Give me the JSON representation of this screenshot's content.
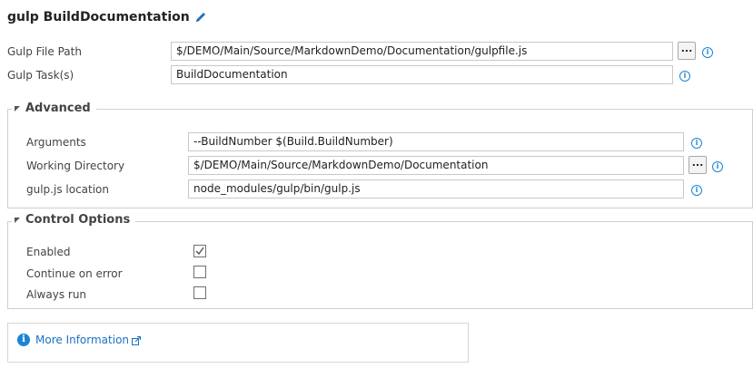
{
  "header": {
    "title": "gulp BuildDocumentation",
    "edit_icon": "pencil-icon"
  },
  "main_fields": {
    "gulp_file_path": {
      "label": "Gulp File Path",
      "value": "$/DEMO/Main/Source/MarkdownDemo/Documentation/gulpfile.js",
      "browse_label": "..."
    },
    "gulp_tasks": {
      "label": "Gulp Task(s)",
      "value": "BuildDocumentation"
    }
  },
  "advanced": {
    "title": "Advanced",
    "arguments": {
      "label": "Arguments",
      "value": "--BuildNumber $(Build.BuildNumber)"
    },
    "working_directory": {
      "label": "Working Directory",
      "value": "$/DEMO/Main/Source/MarkdownDemo/Documentation",
      "browse_label": "..."
    },
    "gulpjs_location": {
      "label": "gulp.js location",
      "value": "node_modules/gulp/bin/gulp.js"
    }
  },
  "control_options": {
    "title": "Control Options",
    "enabled": {
      "label": "Enabled",
      "checked": true
    },
    "continue_on_error": {
      "label": "Continue on error",
      "checked": false
    },
    "always_run": {
      "label": "Always run",
      "checked": false
    }
  },
  "more_information": {
    "label": "More Information",
    "icon": "info-icon",
    "external_icon": "external-link-icon"
  },
  "colors": {
    "accent": "#1a85d4",
    "link": "#1a72c2",
    "border": "#cfcfcf"
  }
}
